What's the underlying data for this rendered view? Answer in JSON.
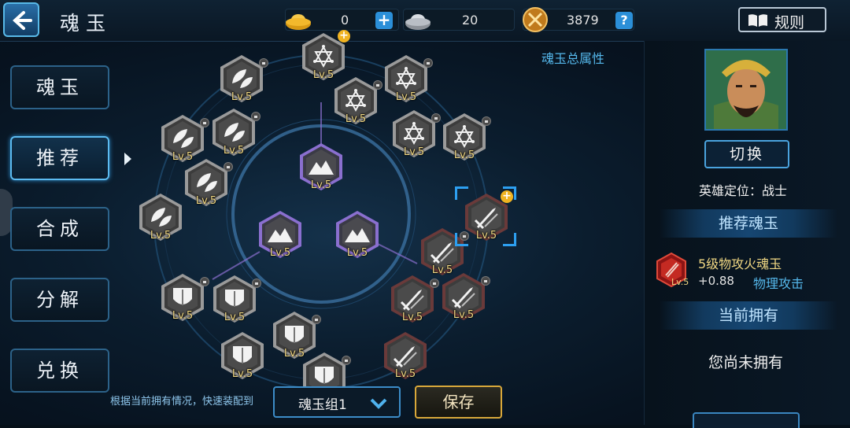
{
  "header": {
    "title": "魂玉",
    "gold_value": "0",
    "silver_value": "20",
    "token_value": "3879",
    "plus_label": "+",
    "help_label": "?",
    "rules_label": "规则"
  },
  "sidebar": {
    "items": [
      {
        "label": "魂玉",
        "active": false
      },
      {
        "label": "推荐",
        "active": true
      },
      {
        "label": "合成",
        "active": false
      },
      {
        "label": "分解",
        "active": false
      },
      {
        "label": "兑换",
        "active": false
      }
    ]
  },
  "gem_board": {
    "level_label": "Lv.5",
    "gems": [
      {
        "type": "star",
        "plus": true,
        "lock": false
      },
      {
        "type": "star",
        "lock": true
      },
      {
        "type": "star",
        "lock": true
      },
      {
        "type": "star",
        "lock": true
      },
      {
        "type": "star",
        "lock": true
      },
      {
        "type": "leaf",
        "lock": true
      },
      {
        "type": "leaf",
        "lock": true
      },
      {
        "type": "leaf",
        "lock": true
      },
      {
        "type": "leaf",
        "lock": true
      },
      {
        "type": "leaf",
        "lock": false
      },
      {
        "type": "mountain",
        "center": true
      },
      {
        "type": "mountain",
        "center": true
      },
      {
        "type": "mountain",
        "center": true
      },
      {
        "type": "sword",
        "plus": true,
        "selected": true
      },
      {
        "type": "sword",
        "lock": true
      },
      {
        "type": "sword",
        "lock": true
      },
      {
        "type": "sword",
        "lock": true
      },
      {
        "type": "sword",
        "lock": false
      },
      {
        "type": "shield",
        "lock": true
      },
      {
        "type": "shield",
        "lock": true
      },
      {
        "type": "shield",
        "lock": true
      },
      {
        "type": "shield",
        "lock": false
      },
      {
        "type": "shield",
        "lock": true
      }
    ]
  },
  "bottom": {
    "hint": "根据当前拥有情况，快速装配到",
    "dropdown_value": "魂玉组1",
    "save_label": "保存"
  },
  "attributes": {
    "title": "魂玉总属性"
  },
  "hero": {
    "switch_label": "切换",
    "role_text": "英雄定位：战士"
  },
  "recommend": {
    "header": "推荐魂玉",
    "gem_name": "5级物攻火魂玉",
    "gem_level": "Lv.5",
    "bonus_value": "+0.88",
    "bonus_type": "物理攻击"
  },
  "owned": {
    "header": "当前拥有",
    "empty_text": "您尚未拥有"
  },
  "colors": {
    "accent": "#55b8ec",
    "gold_text": "#f1d883",
    "active_border": "#5cbbf1"
  }
}
